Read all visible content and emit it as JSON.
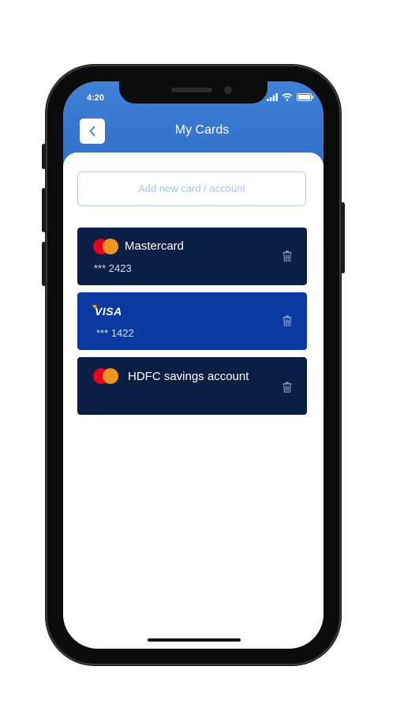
{
  "status_bar": {
    "time": "4:20"
  },
  "header": {
    "title": "My Cards"
  },
  "add_input": {
    "placeholder": "Add new card / account"
  },
  "cards": [
    {
      "brand": "mastercard",
      "name": "Mastercard",
      "number": "*** 2423",
      "color": "#0b1e45"
    },
    {
      "brand": "visa",
      "brand_label": "VISA",
      "number": "*** 1422",
      "color": "#0a3aa0"
    },
    {
      "brand": "mastercard",
      "name": "HDFC savings account",
      "color": "#0b1e45"
    }
  ],
  "colors": {
    "header": "#3f80d8",
    "accent": "#0a3aa0",
    "dark_card": "#0b1e45"
  }
}
